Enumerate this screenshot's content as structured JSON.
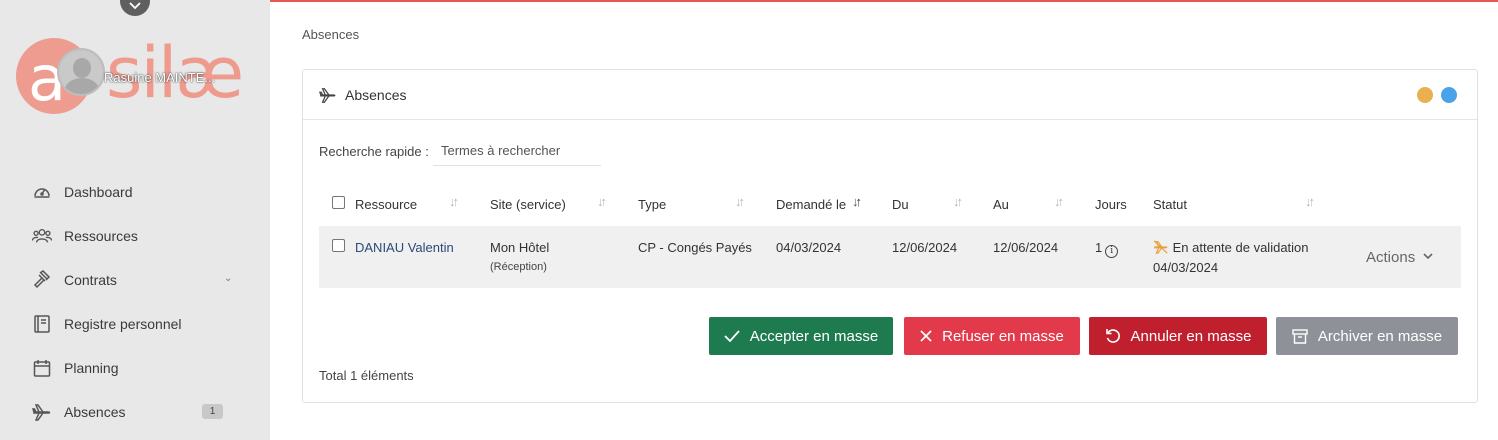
{
  "user": {
    "name": "Rasuine MAINTE..."
  },
  "logo": {
    "text": "silæ",
    "letter": "a"
  },
  "sidebar": {
    "items": [
      {
        "label": "Dashboard",
        "icon": "dashboard-icon"
      },
      {
        "label": "Ressources",
        "icon": "users-icon"
      },
      {
        "label": "Contrats",
        "icon": "gavel-icon",
        "chevron": "⌄"
      },
      {
        "label": "Registre personnel",
        "icon": "register-icon"
      },
      {
        "label": "Planning",
        "icon": "calendar-icon"
      },
      {
        "label": "Absences",
        "icon": "plane-icon",
        "badge": "1"
      }
    ]
  },
  "breadcrumb": "Absences",
  "card": {
    "title": "Absences",
    "dots": [
      "#e8b04e",
      "#4aa3e8"
    ]
  },
  "search": {
    "label": "Recherche rapide :",
    "placeholder": "Termes à rechercher"
  },
  "table": {
    "columns": [
      "Ressource",
      "Site (service)",
      "Type",
      "Demandé le",
      "Du",
      "Au",
      "Jours",
      "Statut"
    ],
    "rows": [
      {
        "resource": "DANIAU Valentin",
        "site": "Mon Hôtel",
        "service": "(Réception)",
        "type": "CP - Congés Payés",
        "requested": "04/03/2024",
        "from": "12/06/2024",
        "to": "12/06/2024",
        "days": "1",
        "status": "En attente de validation",
        "status_date": "04/03/2024",
        "actions": "Actions"
      }
    ]
  },
  "buttons": {
    "accept": "Accepter en masse",
    "refuse": "Refuser en masse",
    "cancel": "Annuler en masse",
    "archive": "Archiver en masse"
  },
  "total": "Total 1 éléments",
  "colors": {
    "accent": "#e25a4e",
    "accept": "#1e7b4f",
    "refuse": "#e23a4a",
    "cancel": "#c0202e",
    "archive": "#8e9198",
    "link": "#2a4a78",
    "pending": "#e8a03a"
  }
}
